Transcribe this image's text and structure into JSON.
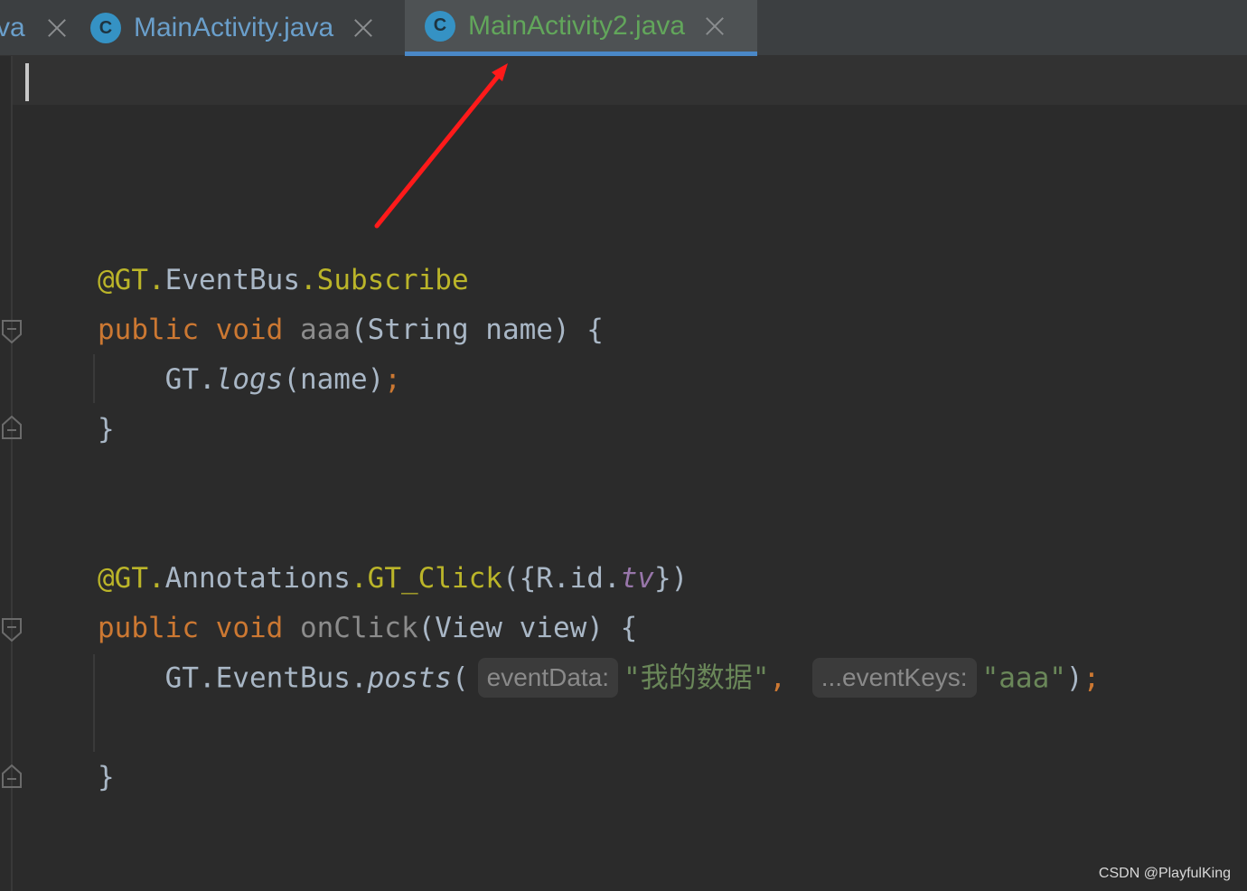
{
  "tabs": [
    {
      "label": "va",
      "active": false
    },
    {
      "label": "MainActivity.java",
      "icon": "C",
      "active": false
    },
    {
      "label": "MainActivity2.java",
      "icon": "C",
      "active": true
    }
  ],
  "code": {
    "line1": {
      "at": "@GT",
      "dot1": ".",
      "cls": "EventBus",
      "dot2": ".",
      "name": "Subscribe"
    },
    "line2": {
      "kw1": "public",
      "kw2": "void",
      "method": "aaa",
      "rest": "(String name) {"
    },
    "line3": {
      "obj": "GT.",
      "call": "logs",
      "args": "(name)",
      "semi": ";"
    },
    "line4": {
      "brace": "}"
    },
    "line5": {
      "at": "@GT",
      "dot1": ".",
      "cls": "Annotations",
      "dot2": ".",
      "name": "GT_Click",
      "open": "({R.id.",
      "field": "tv",
      "close": "})"
    },
    "line6": {
      "kw1": "public",
      "kw2": "void",
      "method": "onClick",
      "rest": "(View view) {"
    },
    "line7": {
      "obj": "GT.EventBus.",
      "call": "posts",
      "open": "(",
      "hint1": "eventData:",
      "str1": "\"我的数据\"",
      "comma": ",",
      "hint2": "...eventKeys:",
      "str2": "\"aaa\"",
      "close": ")",
      "semi": ";"
    },
    "line8": {
      "brace": "}"
    }
  },
  "colors": {
    "annotation": "#bbb529",
    "keyword": "#cc7832",
    "string": "#6a8759",
    "active_tab_text": "#62a65b",
    "arrow": "#ff1a1a"
  },
  "watermark": "CSDN @PlayfulKing"
}
